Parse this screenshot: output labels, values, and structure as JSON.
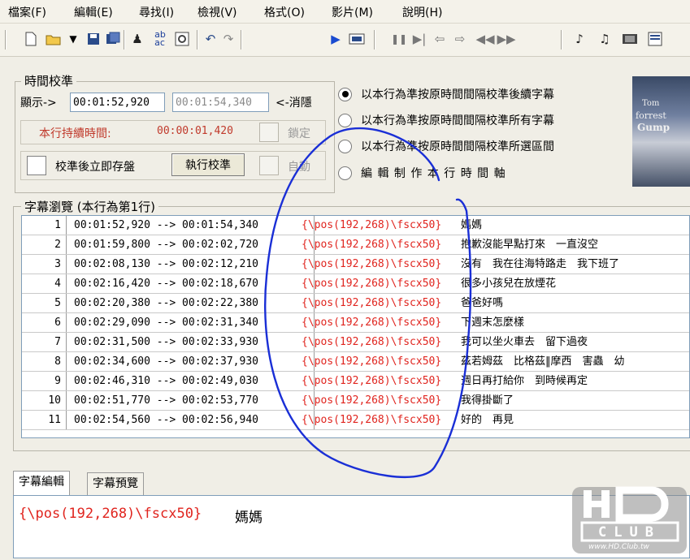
{
  "menu": [
    "檔案(F)",
    "編輯(E)",
    "尋找(I)",
    "檢視(V)",
    "格式(O)",
    "影片(M)",
    "說明(H)"
  ],
  "toolbar_icons": [
    "new-file-icon",
    "open-folder-icon",
    "save-icon",
    "save-all-icon",
    "find-icon",
    "replace-icon",
    "preview-icon",
    "undo-icon",
    "redo-icon",
    "play-icon",
    "video-frame-icon",
    "pause-icon",
    "step-icon",
    "back-icon",
    "forward-icon",
    "rewind-icon",
    "fast-forward-icon",
    "wave-a-icon",
    "wave-b-icon",
    "film-icon",
    "window-icon"
  ],
  "timing": {
    "title": "時間校準",
    "display_label": "顯示->",
    "display_value": "00:01:52,920",
    "target_value": "00:01:54,340",
    "cancel_label": "<-消隱",
    "duration_label": "本行持續時間:",
    "duration_value": "00:00:01,420",
    "lock_label": "鎖定",
    "autosave_label": "校準後立即存盤",
    "execute_button": "執行校準",
    "auto_label": "自動",
    "options": [
      {
        "label": "以本行為準按原時間間隔校準後續字幕",
        "selected": true
      },
      {
        "label": "以本行為準按原時間間隔校準所有字幕",
        "selected": false
      },
      {
        "label": "以本行為準按原時間間隔校準所選區間",
        "selected": false
      },
      {
        "label": "編 輯 制 作 本 行 時 間 軸",
        "selected": false
      }
    ]
  },
  "poster": {
    "line1": "Tom",
    "line2": "forrest",
    "line3": "Gump"
  },
  "subtitle_list": {
    "title": "字幕瀏覽 (本行為第1行)",
    "rows": [
      {
        "num": "1",
        "time": "00:01:52,920 --> 00:01:54,340",
        "tag": "{\\pos(192,268)\\fscx50}",
        "text": "媽媽"
      },
      {
        "num": "2",
        "time": "00:01:59,800 --> 00:02:02,720",
        "tag": "{\\pos(192,268)\\fscx50}",
        "text": "抱歉沒能早點打來　一直沒空"
      },
      {
        "num": "3",
        "time": "00:02:08,130 --> 00:02:12,210",
        "tag": "{\\pos(192,268)\\fscx50}",
        "text": "沒有　我在往海特路走　我下班了"
      },
      {
        "num": "4",
        "time": "00:02:16,420 --> 00:02:18,670",
        "tag": "{\\pos(192,268)\\fscx50}",
        "text": "很多小孩兒在放煙花"
      },
      {
        "num": "5",
        "time": "00:02:20,380 --> 00:02:22,380",
        "tag": "{\\pos(192,268)\\fscx50}",
        "text": "爸爸好嗎"
      },
      {
        "num": "6",
        "time": "00:02:29,090 --> 00:02:31,340",
        "tag": "{\\pos(192,268)\\fscx50}",
        "text": "下週末怎麼樣"
      },
      {
        "num": "7",
        "time": "00:02:31,500 --> 00:02:33,930",
        "tag": "{\\pos(192,268)\\fscx50}",
        "text": "我可以坐火車去　留下過夜"
      },
      {
        "num": "8",
        "time": "00:02:34,600 --> 00:02:37,930",
        "tag": "{\\pos(192,268)\\fscx50}",
        "text": "茲若姆茲　比格茲‖摩西　害蟲　幼"
      },
      {
        "num": "9",
        "time": "00:02:46,310 --> 00:02:49,030",
        "tag": "{\\pos(192,268)\\fscx50}",
        "text": "週日再打給你　到時候再定"
      },
      {
        "num": "10",
        "time": "00:02:51,770 --> 00:02:53,770",
        "tag": "{\\pos(192,268)\\fscx50}",
        "text": "我得掛斷了"
      },
      {
        "num": "11",
        "time": "00:02:54,560 --> 00:02:56,940",
        "tag": "{\\pos(192,268)\\fscx50}",
        "text": "好的　再見"
      }
    ]
  },
  "tabs": [
    "字幕編輯",
    "字幕預覽"
  ],
  "editor": {
    "tag": "{\\pos(192,268)\\fscx50}",
    "text": "媽媽"
  },
  "logo": {
    "main": "HD",
    "sub": "CLUB",
    "url": "www.HD.Club.tw"
  },
  "colors": {
    "tag_red": "#e0241e",
    "annotation_blue": "#1a2fd6",
    "duration_red": "#c0392b"
  }
}
